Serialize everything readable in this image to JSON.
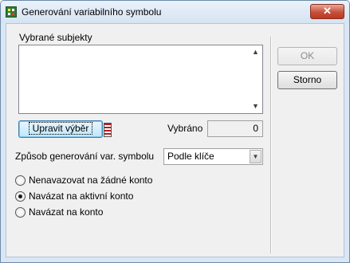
{
  "window": {
    "title": "Generování variabilního symbolu",
    "close_symbol": "✕"
  },
  "selected_subjects": {
    "label": "Vybrané subjekty",
    "items": []
  },
  "edit_selection": {
    "label": "Upravit výběr",
    "filter_icon": "filter-icon"
  },
  "selected_count": {
    "label": "Vybráno",
    "value": "0"
  },
  "generation_method": {
    "label": "Způsob generování var. symbolu",
    "selected": "Podle klíče"
  },
  "radio_options": [
    {
      "label": "Nenavazovat na žádné konto",
      "checked": false
    },
    {
      "label": "Navázat na aktivní konto",
      "checked": true
    },
    {
      "label": "Navázat na konto",
      "checked": false
    }
  ],
  "buttons": {
    "ok": "OK",
    "cancel": "Storno"
  }
}
